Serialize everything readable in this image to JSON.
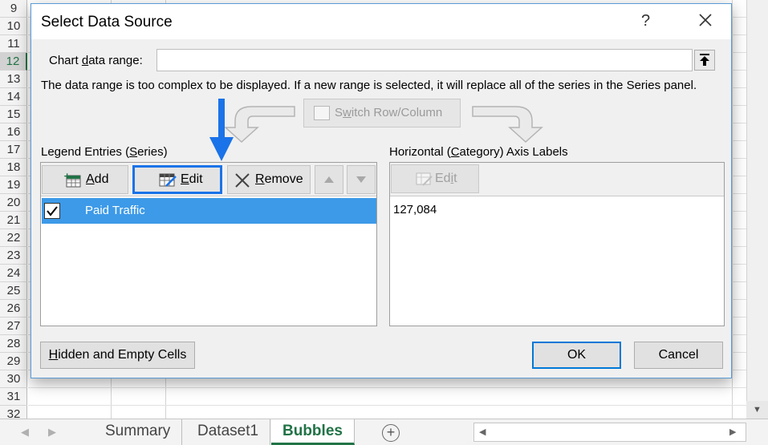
{
  "sheet": {
    "rows": [
      "9",
      "10",
      "11",
      "12",
      "13",
      "14",
      "15",
      "16",
      "17",
      "18",
      "19",
      "20",
      "21",
      "22",
      "23",
      "24",
      "25",
      "26",
      "27",
      "28",
      "29",
      "30",
      "31",
      "32"
    ],
    "selected_row": "12",
    "tabs": [
      {
        "label": "Summary",
        "active": false
      },
      {
        "label": "Dataset1",
        "active": false
      },
      {
        "label": "Bubbles",
        "active": true
      }
    ],
    "add_sheet_symbol": "+"
  },
  "dialog": {
    "title": "Select Data Source",
    "help_symbol": "?",
    "chart_range_label_pre": "Chart ",
    "chart_range_label_key": "d",
    "chart_range_label_post": "ata range:",
    "chart_range_value": "",
    "info_message": "The data range is too complex to be displayed. If a new range is selected, it will replace all of the series in the Series panel.",
    "switch_label_pre": "S",
    "switch_label_key": "w",
    "switch_label_post": "itch Row/Column",
    "legend": {
      "heading_pre": "Legend Entries (",
      "heading_key": "S",
      "heading_post": "eries)",
      "add_key": "A",
      "add_rest": "dd",
      "edit_key": "E",
      "edit_rest": "dit",
      "remove_key": "R",
      "remove_rest": "emove",
      "series": [
        {
          "name": "Paid Traffic",
          "checked": true
        }
      ]
    },
    "axis": {
      "heading_pre": "Horizontal (",
      "heading_key": "C",
      "heading_post": "ategory) Axis Labels",
      "edit_pre": "Ed",
      "edit_key": "i",
      "edit_post": "t",
      "values": [
        "127,084"
      ]
    },
    "hidden_cells_key": "H",
    "hidden_cells_rest": "idden and Empty Cells",
    "ok_label": "OK",
    "cancel_label": "Cancel"
  },
  "colors": {
    "accent_blue": "#1a73e8",
    "selection_blue": "#3d9ae8",
    "excel_green": "#217346"
  }
}
